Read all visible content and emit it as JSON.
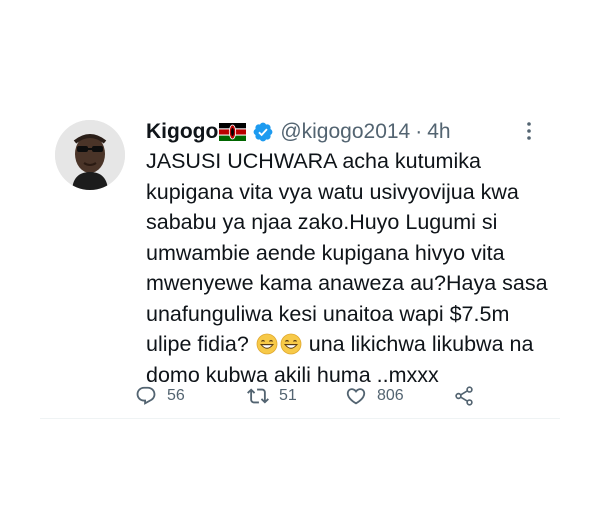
{
  "tweet": {
    "display_name": "Kigogo",
    "handle": "@kigogo2014",
    "separator": "·",
    "time": "4h",
    "text_parts": [
      "JASUSI UCHWARA acha kutumika kupigana vita vya watu usivyovijua kwa sababu ya njaa zako.Huyo Lugumi si umwambie aende kupigana hivyo vita mwenyewe kama anaweza au?Haya sasa unafunguliwa kesi unaitoa wapi $7.5m ulipe fidia? ",
      " una likichwa likubwa na domo kubwa akili huma ..mxxx"
    ],
    "emojis": [
      "grinning-face-with-smiling-eyes",
      "grinning-face-with-smiling-eyes"
    ],
    "flag": "kenya-flag-icon",
    "verified_color": "#1d9bf0"
  },
  "actions": {
    "reply_count": "56",
    "retweet_count": "51",
    "like_count": "806"
  },
  "icons": {
    "reply": "reply-icon",
    "retweet": "retweet-icon",
    "like": "heart-icon",
    "share": "share-icon",
    "more": "more-options-icon"
  },
  "colors": {
    "text_primary": "#0f1419",
    "text_secondary": "#536471",
    "verified": "#1d9bf0"
  }
}
